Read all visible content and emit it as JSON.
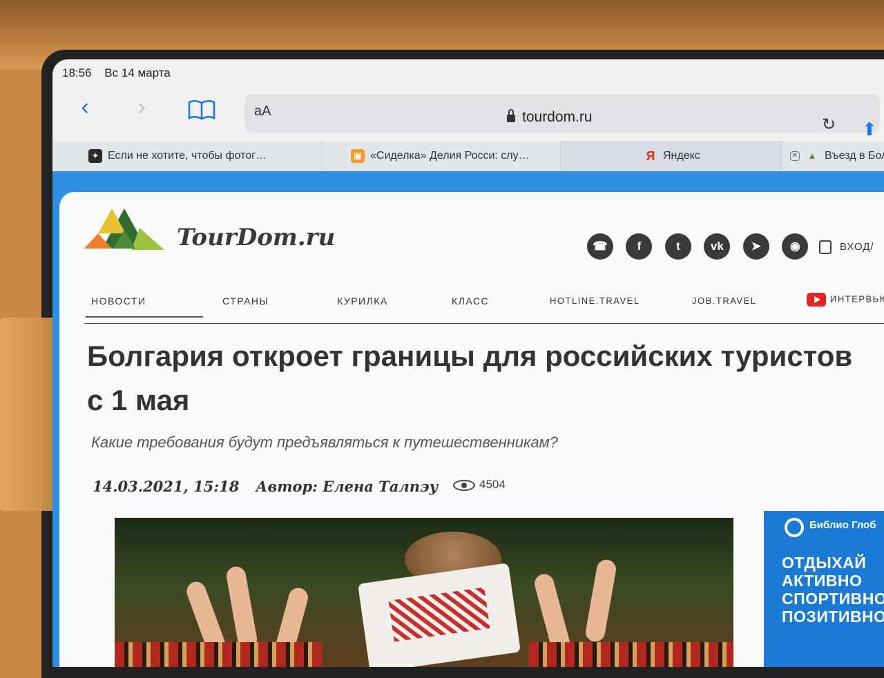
{
  "status_bar": {
    "time": "18:56",
    "date": "Вс 14 марта"
  },
  "browser": {
    "aa_label": "aA",
    "url": "tourdom.ru",
    "tabs": [
      {
        "label": "Если не хотите, чтобы фотог…",
        "icon": "sparkle-icon"
      },
      {
        "label": "«Сиделка» Делия Росси: слу…",
        "icon": "book-icon"
      },
      {
        "label": "Яндекс",
        "icon": "yandex-icon"
      },
      {
        "label": "Въезд в Болг",
        "icon": "tourdom-favicon"
      }
    ]
  },
  "site": {
    "logo_text": "TourDom.ru",
    "login_label": "ВХОД/",
    "nav": [
      "НОВОСТИ",
      "СТРАНЫ",
      "КУРИЛКА",
      "КЛАСС",
      "HOTLINE.TRAVEL",
      "JOB.TRAVEL",
      "ИНТЕРВЬЮ"
    ],
    "social_icons": [
      "phone-icon",
      "facebook-icon",
      "twitter-icon",
      "vk-icon",
      "telegram-icon",
      "rss-icon"
    ]
  },
  "article": {
    "headline": "Болгария откроет границы для российских туристов с 1 мая",
    "subtitle": "Какие требования будут предъявляться к путешественникам?",
    "date": "14.03.2021, 15:18",
    "author": "Автор: Елена Талпэу",
    "views": "4504"
  },
  "ad": {
    "brand": "Библио Глоб",
    "lines": [
      "ОТДЫХАЙ",
      "АКТИВНО",
      "СПОРТИВНО",
      "ПОЗИТИВНО"
    ]
  },
  "colors": {
    "accent": "#1a73e8",
    "site_blue": "#2f8ee0",
    "ad_blue": "#1b7bd4"
  }
}
